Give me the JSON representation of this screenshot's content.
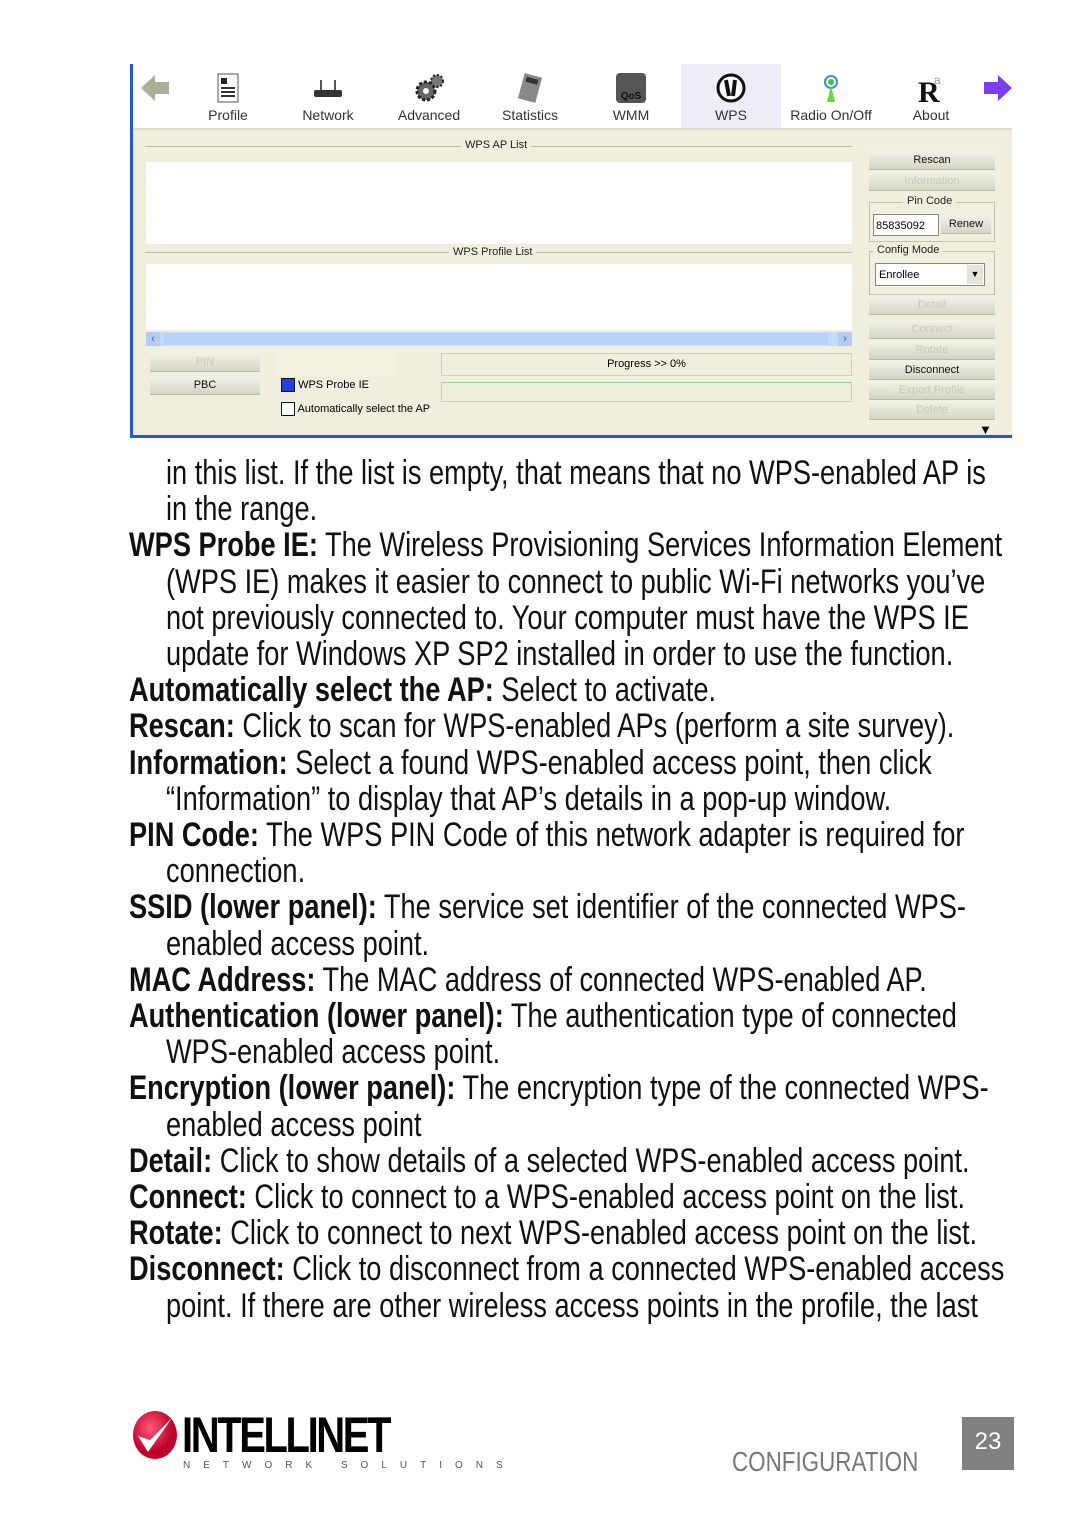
{
  "screenshot": {
    "toolbar": [
      {
        "label": "",
        "icon": "back-arrow-icon"
      },
      {
        "label": "Profile",
        "icon": "profile-icon"
      },
      {
        "label": "Network",
        "icon": "router-icon"
      },
      {
        "label": "Advanced",
        "icon": "gears-icon"
      },
      {
        "label": "Statistics",
        "icon": "calculator-icon"
      },
      {
        "label": "WMM",
        "icon": "qos-icon",
        "icon_text": "QoS"
      },
      {
        "label": "WPS",
        "icon": "wps-icon",
        "selected": true
      },
      {
        "label": "Radio On/Off",
        "icon": "antenna-icon"
      },
      {
        "label": "About",
        "icon": "about-icon"
      },
      {
        "label": "",
        "icon": "forward-arrow-icon"
      }
    ],
    "wps_ap_list": "WPS AP List",
    "wps_profile_list": "WPS Profile List",
    "pin_button": "PIN",
    "pbc_button": "PBC",
    "wps_probe_ie": {
      "label": "WPS Probe IE",
      "checked": true
    },
    "auto_select": {
      "label": "Automatically select the AP",
      "checked": false
    },
    "progress": "Progress >> 0%",
    "progress_value": 0,
    "rescan": "Rescan",
    "information": "Information",
    "pin_code_label": "Pin Code",
    "pin_code_value": "85835092",
    "renew": "Renew",
    "config_mode_label": "Config Mode",
    "config_mode_value": "Enrollee",
    "detail": "Detail",
    "connect": "Connect",
    "rotate": "Rotate",
    "disconnect": "Disconnect",
    "export_profile": "Export Profile",
    "delete": "Delete",
    "colors": {
      "accent": "#2a55d8",
      "panel": "#f0efdd"
    }
  },
  "body_lines": [
    {
      "term": "",
      "text": "in this list. If the list is empty, that means that no WPS-enabled AP is",
      "indent": true
    },
    {
      "term": "",
      "text": "in the range.",
      "indent": true
    },
    {
      "term": "WPS Probe IE:",
      "text": " The Wireless Provisioning Services Information Element",
      "indent": false
    },
    {
      "term": "",
      "text": "(WPS IE) makes it easier to connect to public Wi-Fi networks you’ve",
      "indent": true
    },
    {
      "term": "",
      "text": "not previously connected to. Your computer must have the WPS IE",
      "indent": true
    },
    {
      "term": "",
      "text": "update for Windows XP SP2 installed in order to use the function.",
      "indent": true
    },
    {
      "term": "Automatically select the AP:",
      "text": " Select to activate.",
      "indent": false
    },
    {
      "term": "Rescan:",
      "text": " Click to scan for WPS-enabled APs (perform a site survey).",
      "indent": false
    },
    {
      "term": "Information:",
      "text": " Select a found WPS-enabled access point, then click",
      "indent": false
    },
    {
      "term": "",
      "text": "“Information” to display that AP’s details in a pop-up window.",
      "indent": true
    },
    {
      "term": "PIN Code:",
      "text": " The WPS PIN Code of this network adapter is required for",
      "indent": false
    },
    {
      "term": "",
      "text": "connection.",
      "indent": true
    },
    {
      "term": "SSID (lower panel):",
      "text": " The service set identifier of the connected WPS-",
      "indent": false
    },
    {
      "term": "",
      "text": "enabled access point.",
      "indent": true
    },
    {
      "term": "MAC Address:",
      "text": " The MAC address of connected WPS-enabled AP.",
      "indent": false
    },
    {
      "term": "Authentication (lower panel):",
      "text": " The authentication type of connected",
      "indent": false
    },
    {
      "term": "",
      "text": "WPS-enabled access point.",
      "indent": true
    },
    {
      "term": "Encryption (lower panel):",
      "text": " The encryption type of the connected WPS-",
      "indent": false
    },
    {
      "term": "",
      "text": "enabled access point",
      "indent": true
    },
    {
      "term": "Detail:",
      "text": " Click to show details of a selected WPS-enabled access point.",
      "indent": false
    },
    {
      "term": "Connect:",
      "text": " Click to connect to a WPS-enabled access point on the list.",
      "indent": false
    },
    {
      "term": "Rotate:",
      "text": " Click to connect to next WPS-enabled access point on the list.",
      "indent": false
    },
    {
      "term": "Disconnect:",
      "text": " Click to disconnect from a connected WPS-enabled access",
      "indent": false
    },
    {
      "term": "",
      "text": "point. If there are other wireless access points in the profile, the last",
      "indent": true
    }
  ],
  "footer": {
    "logo": "INTELLINET",
    "logo_tagline": "NETWORK SOLUTIONS",
    "section": "CONFIGURATION",
    "page_number": "23"
  }
}
